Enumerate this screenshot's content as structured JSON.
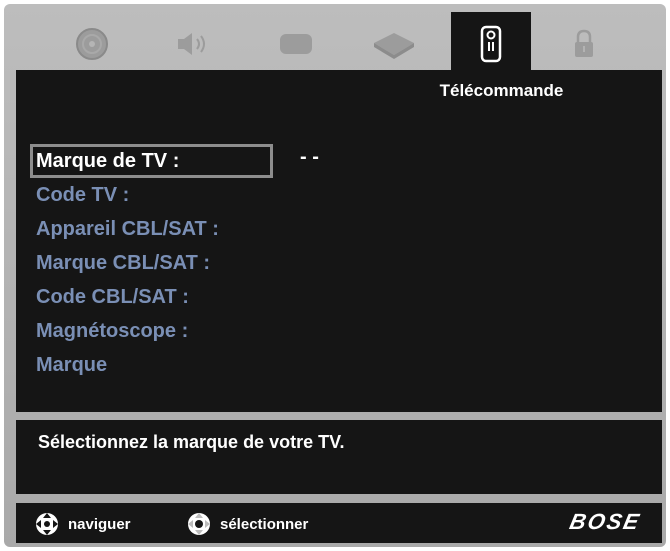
{
  "tabs": [
    {
      "icon": "disc-icon",
      "active": false
    },
    {
      "icon": "speaker-icon",
      "active": false
    },
    {
      "icon": "tv-screen-icon",
      "active": false
    },
    {
      "icon": "dvd-player-icon",
      "active": false
    },
    {
      "icon": "remote-control-icon",
      "active": true
    },
    {
      "icon": "lock-icon",
      "active": false
    }
  ],
  "active_tab_title": "Télécommande",
  "fields": [
    {
      "label": "Marque de TV :",
      "selected": true
    },
    {
      "label": "Code TV :",
      "selected": false
    },
    {
      "label": "Appareil CBL/SAT :",
      "selected": false
    },
    {
      "label": "Marque CBL/SAT :",
      "selected": false
    },
    {
      "label": "Code CBL/SAT :",
      "selected": false
    },
    {
      "label": "Magnétoscope :",
      "selected": false
    },
    {
      "label": "Marque",
      "selected": false
    }
  ],
  "selected_value": "- -",
  "help_text": "Sélectionnez la marque de votre TV.",
  "footer": {
    "navigate_label": "naviguer",
    "select_label": "sélectionner",
    "brand": "BOSE"
  },
  "colors": {
    "panel_bg": "#151515",
    "frame_bg": "#b3b3b3",
    "field_text": "#7a8fb5",
    "selected_text": "#ffffff"
  }
}
